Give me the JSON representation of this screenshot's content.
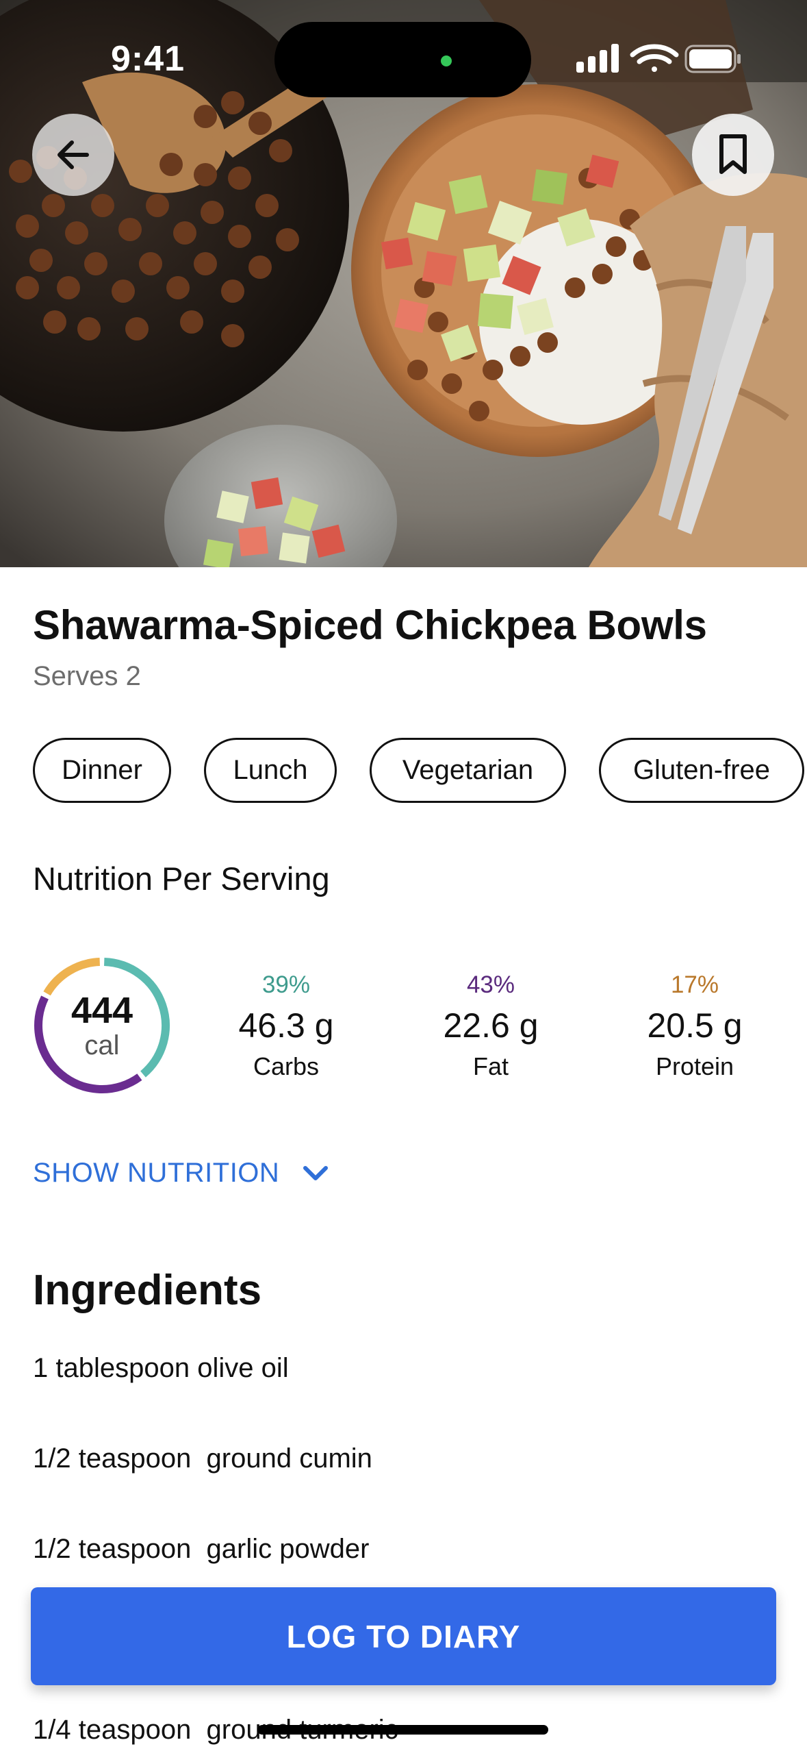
{
  "status_bar": {
    "time": "9:41"
  },
  "header": {
    "back_icon": "arrow-left-icon",
    "bookmark_icon": "bookmark-icon"
  },
  "recipe": {
    "title": "Shawarma-Spiced Chickpea Bowls",
    "serves": "Serves 2",
    "tags": [
      "Dinner",
      "Lunch",
      "Vegetarian",
      "Gluten-free"
    ]
  },
  "nutrition": {
    "heading": "Nutrition Per Serving",
    "calories": "444",
    "calories_unit": "cal",
    "macros": [
      {
        "percent": "39%",
        "amount": "46.3 g",
        "label": "Carbs",
        "color": "#3e9b8d",
        "ring_color": "#5bbbb0",
        "fraction": 0.39
      },
      {
        "percent": "43%",
        "amount": "22.6 g",
        "label": "Fat",
        "color": "#5a2a7d",
        "ring_color": "#6a2c90",
        "fraction": 0.43
      },
      {
        "percent": "17%",
        "amount": "20.5 g",
        "label": "Protein",
        "color": "#b9782b",
        "ring_color": "#eeb24f",
        "fraction": 0.17
      }
    ],
    "show_more_label": "SHOW NUTRITION"
  },
  "ingredients": {
    "heading": "Ingredients",
    "items": [
      "1 tablespoon olive oil",
      "1/2 teaspoon  ground cumin",
      "1/2 teaspoon  garlic powder",
      "1/4 teaspoon  ground turmeric"
    ]
  },
  "actions": {
    "log_label": "LOG TO DIARY"
  },
  "colors": {
    "accent": "#3369e7",
    "link": "#2f6fd8"
  }
}
